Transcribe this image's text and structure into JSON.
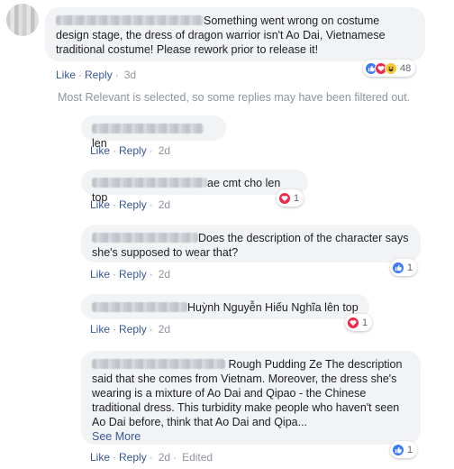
{
  "main_comment": {
    "text": "Something went wrong on costume design stage, the dress of dragon warrior isn't Ao Dai, Vietnamese traditional costume! Please rework prior to release it!",
    "like": "Like",
    "reply": "Reply",
    "time": "3d",
    "reaction_count": "48"
  },
  "filter_note": "Most Relevant is selected, so some replies may have been filtered out.",
  "replies": [
    {
      "text": "len",
      "like": "Like",
      "reply": "Reply",
      "time": "2d"
    },
    {
      "text": "ae cmt cho len top",
      "like": "Like",
      "reply": "Reply",
      "time": "2d",
      "reaction_count": "1"
    },
    {
      "text": "Does the description of the character says she's supposed to wear that?",
      "like": "Like",
      "reply": "Reply",
      "time": "2d",
      "reaction_count": "1"
    },
    {
      "text": "Huỳnh Nguyễn Hiếu Nghĩa lên top",
      "like": "Like",
      "reply": "Reply",
      "time": "2d",
      "reaction_count": "1"
    },
    {
      "text": "Rough Pudding Ze The description said that she comes from Vietnam. Moreover, the dress she's wearing is a mixture of Ao Dai and Qipao - the Chinese traditional dress. This turbidity make people who haven't seen Ao Dai before, think that Ao Dai and Qipa...",
      "see_more": "See More",
      "like": "Like",
      "reply": "Reply",
      "time": "2d",
      "edited": "Edited",
      "reaction_count": "1"
    }
  ],
  "icons": [
    "like-reaction-icon",
    "love-reaction-icon",
    "haha-reaction-icon"
  ],
  "colors": {
    "link": "#385898",
    "bubble": "#f2f3f5",
    "like": "#3b7cf2",
    "love": "#f0284a"
  }
}
